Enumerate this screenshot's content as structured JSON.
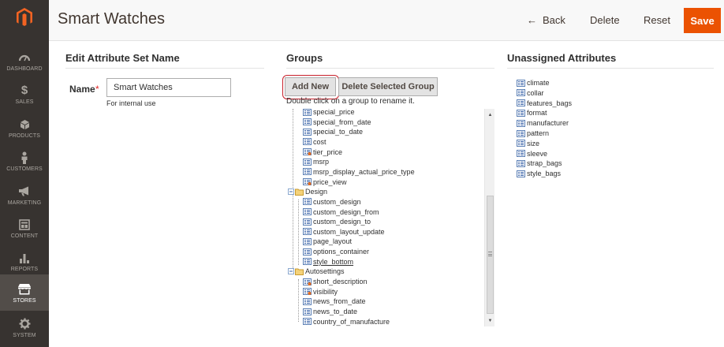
{
  "header": {
    "title": "Smart Watches",
    "back_arrow": "←",
    "back_label": "Back",
    "delete_label": "Delete",
    "reset_label": "Reset",
    "save_label": "Save"
  },
  "sidebar": {
    "items": [
      {
        "label": "DASHBOARD",
        "icon": "dashboard-icon"
      },
      {
        "label": "SALES",
        "icon": "dollar-icon"
      },
      {
        "label": "PRODUCTS",
        "icon": "cube-icon"
      },
      {
        "label": "CUSTOMERS",
        "icon": "person-icon"
      },
      {
        "label": "MARKETING",
        "icon": "megaphone-icon"
      },
      {
        "label": "CONTENT",
        "icon": "layout-icon"
      },
      {
        "label": "REPORTS",
        "icon": "bar-chart-icon"
      },
      {
        "label": "STORES",
        "icon": "store-icon",
        "active": true
      },
      {
        "label": "SYSTEM",
        "icon": "gear-icon"
      }
    ]
  },
  "edit_section": {
    "title": "Edit Attribute Set Name",
    "name_label": "Name",
    "required_mark": "*",
    "name_value": "Smart Watches",
    "name_note": "For internal use"
  },
  "groups_section": {
    "title": "Groups",
    "add_new_label": "Add New",
    "delete_group_label": "Delete Selected Group",
    "hint": "Double click on a group to rename it.",
    "tree": [
      {
        "type": "attr",
        "label": "special_price"
      },
      {
        "type": "attr",
        "label": "special_from_date"
      },
      {
        "type": "attr",
        "label": "special_to_date"
      },
      {
        "type": "attr",
        "label": "cost"
      },
      {
        "type": "attr-user",
        "label": "tier_price"
      },
      {
        "type": "attr",
        "label": "msrp"
      },
      {
        "type": "attr",
        "label": "msrp_display_actual_price_type"
      },
      {
        "type": "attr-user",
        "label": "price_view"
      },
      {
        "type": "group",
        "label": "Design"
      },
      {
        "type": "attr",
        "label": "custom_design"
      },
      {
        "type": "attr",
        "label": "custom_design_from"
      },
      {
        "type": "attr",
        "label": "custom_design_to"
      },
      {
        "type": "attr",
        "label": "custom_layout_update"
      },
      {
        "type": "attr",
        "label": "page_layout"
      },
      {
        "type": "attr",
        "label": "options_container"
      },
      {
        "type": "attr",
        "label": "style_bottom",
        "underline": true
      },
      {
        "type": "group",
        "label": "Autosettings"
      },
      {
        "type": "attr-user",
        "label": "short_description"
      },
      {
        "type": "attr-user",
        "label": "visibility"
      },
      {
        "type": "attr",
        "label": "news_from_date"
      },
      {
        "type": "attr",
        "label": "news_to_date"
      },
      {
        "type": "attr",
        "label": "country_of_manufacture"
      }
    ]
  },
  "unassigned_section": {
    "title": "Unassigned Attributes",
    "items": [
      "climate",
      "collar",
      "features_bags",
      "format",
      "manufacturer",
      "pattern",
      "size",
      "sleeve",
      "strap_bags",
      "style_bags"
    ]
  },
  "colors": {
    "sidebar_bg": "#373330",
    "sidebar_active": "#524d49",
    "save_button": "#eb5202",
    "required": "#e22626",
    "highlight_ring": "#c8202b"
  }
}
